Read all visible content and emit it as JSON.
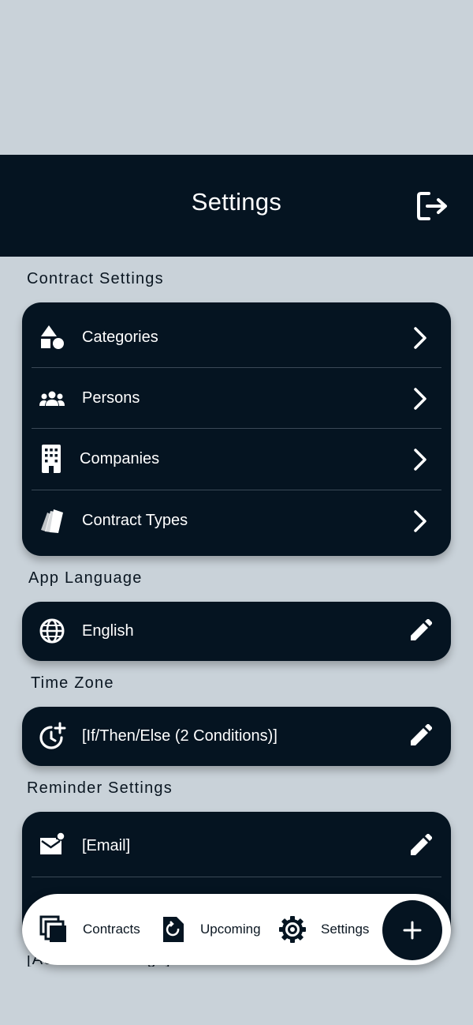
{
  "header": {
    "title": "Settings"
  },
  "sections": {
    "contract": {
      "title": "Contract Settings",
      "items": [
        {
          "label": "Categories"
        },
        {
          "label": "Persons"
        },
        {
          "label": "Companies"
        },
        {
          "label": "Contract Types"
        }
      ]
    },
    "language": {
      "title": "App Language",
      "value": "English"
    },
    "timezone": {
      "title": "Time Zone",
      "value": "[If/Then/Else (2 Conditions)]"
    },
    "reminder": {
      "title": "Reminder Settings",
      "items": [
        {
          "label": "[Email]"
        }
      ]
    },
    "account": {
      "title": "[Account Settings]"
    }
  },
  "nav": {
    "contracts": "Contracts",
    "upcoming": "Upcoming",
    "settings": "Settings"
  },
  "colors": {
    "background": "#c9d2d9",
    "dark": "#051421",
    "white": "#ffffff"
  }
}
